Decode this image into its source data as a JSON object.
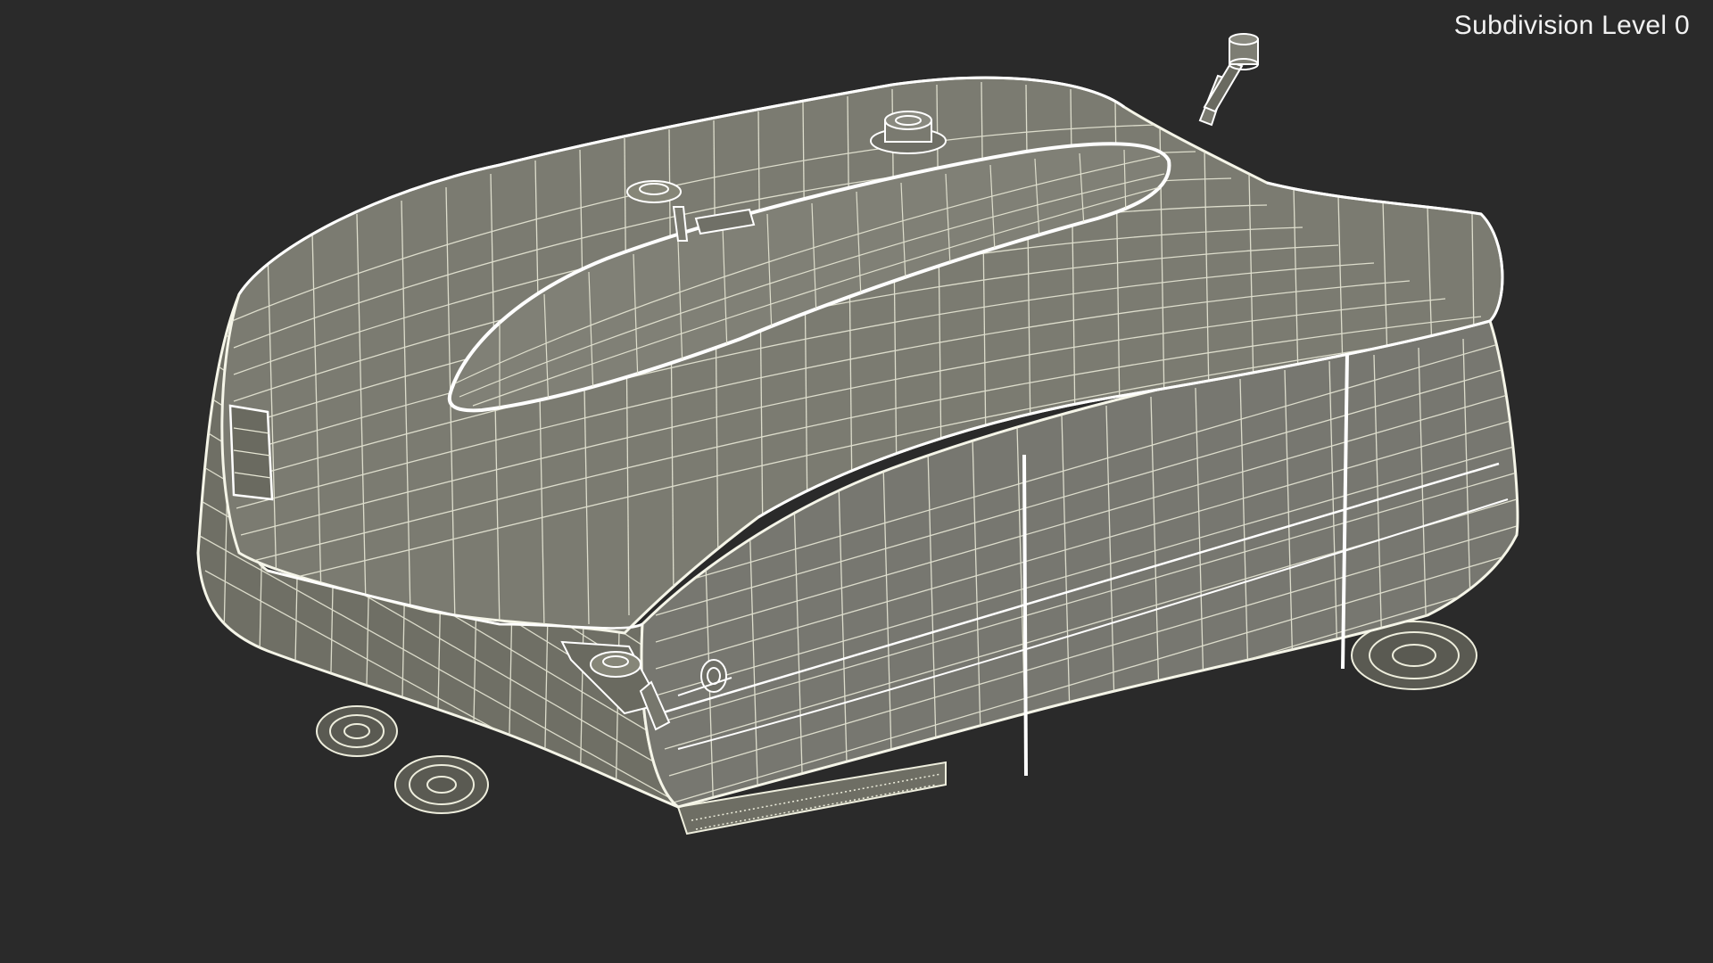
{
  "viewport": {
    "overlay_label": "Subdivision Level 0"
  },
  "colors": {
    "background": "#2a2a2a",
    "body_fill": "#7a7a6f",
    "body_fill_dark": "#6b6b61",
    "wire": "#eeeedd",
    "edge": "#ffffff"
  }
}
